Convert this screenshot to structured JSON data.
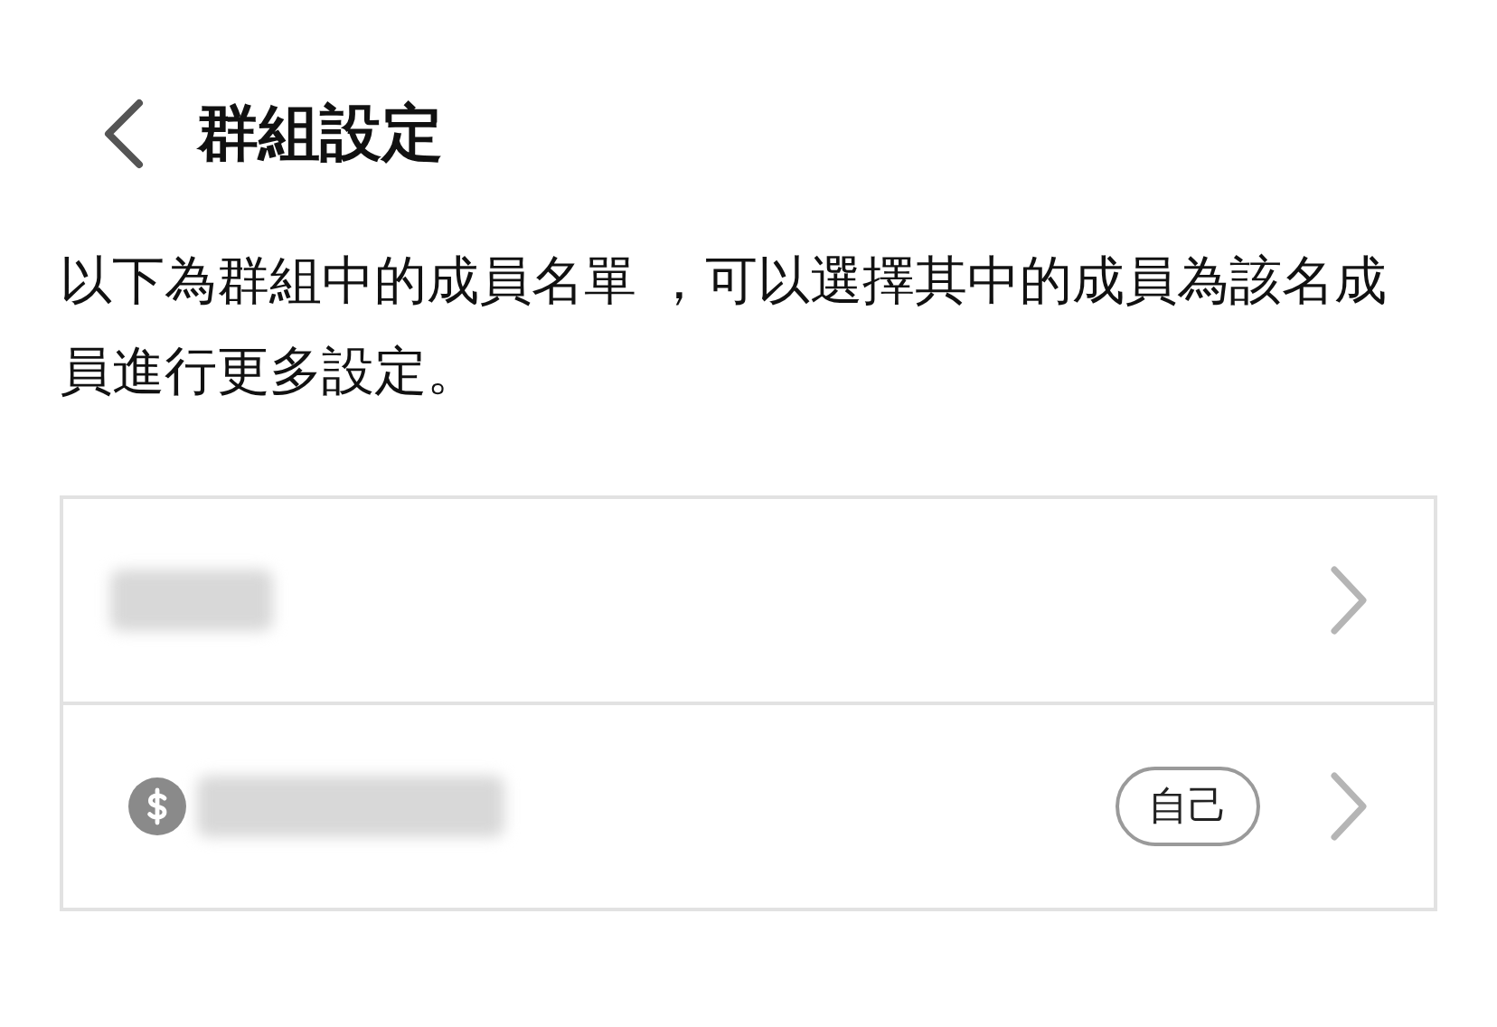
{
  "header": {
    "title": "群組設定"
  },
  "description": "以下為群組中的成員名單 ，可以選擇其中的成員為該名成員進行更多設定。",
  "members": [
    {
      "has_dollar_icon": false
    },
    {
      "has_dollar_icon": true,
      "badge": "自己"
    }
  ]
}
